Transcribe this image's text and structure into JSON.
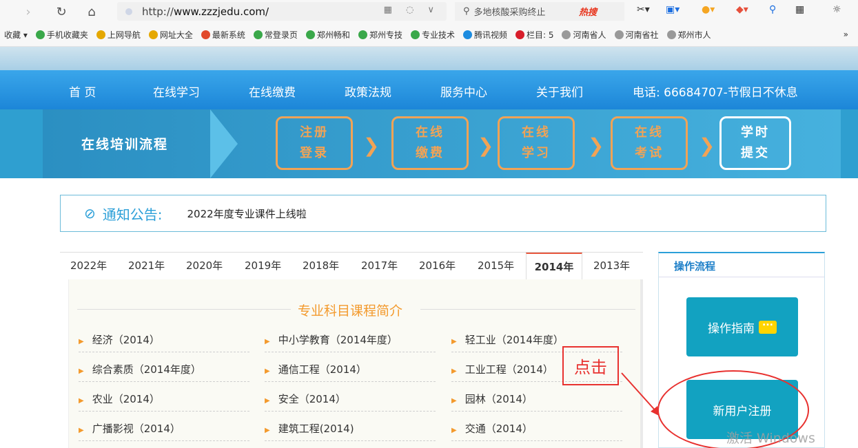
{
  "browser": {
    "url_prefix": "http://",
    "url_domain": "www.zzzjedu.com/",
    "search_text": "多地核酸采购终止",
    "search_hot": "热搜"
  },
  "bookmarks": [
    {
      "label": "收藏 ▾",
      "color": ""
    },
    {
      "label": "手机收藏夹",
      "color": "#3aa84a"
    },
    {
      "label": "上网导航",
      "color": "#e5a800"
    },
    {
      "label": "网址大全",
      "color": "#e5a800"
    },
    {
      "label": "最新系统",
      "color": "#e14a2c"
    },
    {
      "label": "常登录页",
      "color": "#3aa84a"
    },
    {
      "label": "郑州畅和",
      "color": "#3aa84a"
    },
    {
      "label": "郑州专技",
      "color": "#3aa84a"
    },
    {
      "label": "专业技术",
      "color": "#3aa84a"
    },
    {
      "label": "腾讯视频",
      "color": "#1d8ce0"
    },
    {
      "label": "栏目: 5",
      "color": "#d81e2b"
    },
    {
      "label": "河南省人",
      "color": "#999"
    },
    {
      "label": "河南省社",
      "color": "#999"
    },
    {
      "label": "郑州市人",
      "color": "#999"
    }
  ],
  "bookmarks_more": "»",
  "nav": {
    "home": "首 页",
    "study": "在线学习",
    "pay": "在线缴费",
    "policy": "政策法规",
    "service": "服务中心",
    "about": "关于我们",
    "phone": "电话: 66684707-节假日不休息"
  },
  "process": {
    "title": "在线培训流程",
    "steps": [
      {
        "l1": "注册",
        "l2": "登录"
      },
      {
        "l1": "在线",
        "l2": "缴费"
      },
      {
        "l1": "在线",
        "l2": "学习"
      },
      {
        "l1": "在线",
        "l2": "考试"
      },
      {
        "l1": "学时",
        "l2": "提交"
      }
    ]
  },
  "notice": {
    "label": "通知公告:",
    "text": "2022年度专业课件上线啦"
  },
  "tabs": [
    "2022年",
    "2021年",
    "2020年",
    "2019年",
    "2018年",
    "2017年",
    "2016年",
    "2015年",
    "2014年",
    "2013年"
  ],
  "active_tab": "2014年",
  "panel_title": "专业科目课程简介",
  "courses": [
    "经济（2014）",
    "中小学教育（2014年度）",
    "轻工业（2014年度）",
    "综合素质（2014年度）",
    "通信工程（2014）",
    "工业工程（2014）",
    "农业（2014）",
    "安全（2014）",
    "园林（2014）",
    "广播影视（2014）",
    "建筑工程(2014)",
    "交通（2014）"
  ],
  "sidebar": {
    "title": "操作流程",
    "guide": "操作指南",
    "register": "新用户注册"
  },
  "annotation_click": "点击",
  "watermark": "激活 Windows",
  "colors": {
    "nav": "#1c86d8",
    "accent": "#f39a2d",
    "teal": "#12a2c1",
    "annotation": "#e8312f"
  }
}
